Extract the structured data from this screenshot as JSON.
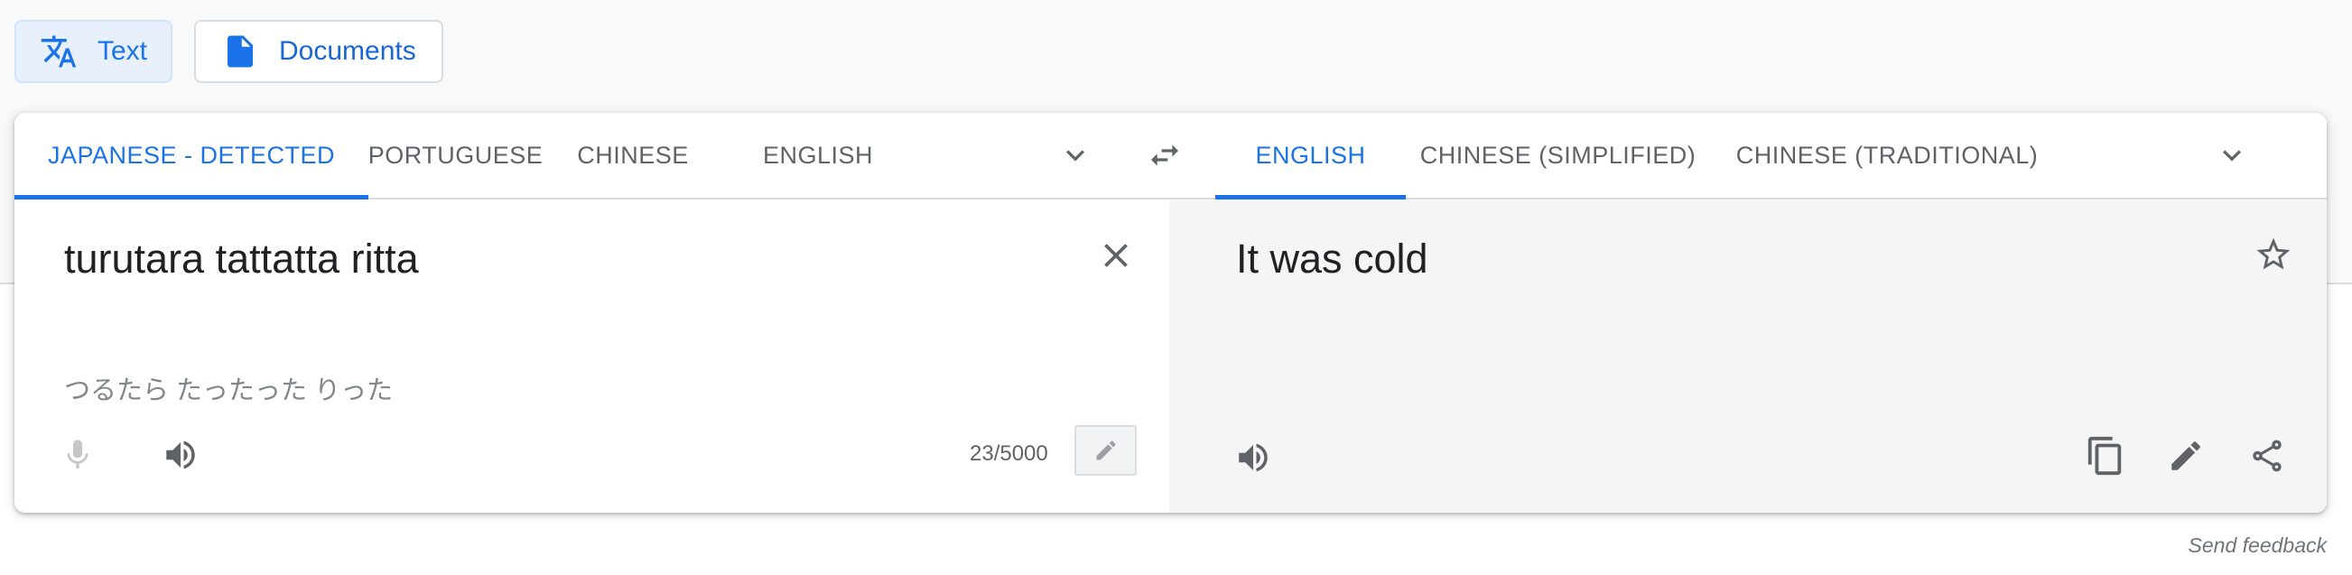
{
  "mode_buttons": {
    "text_label": "Text",
    "documents_label": "Documents"
  },
  "source_languages": [
    "JAPANESE - DETECTED",
    "PORTUGUESE",
    "CHINESE",
    "ENGLISH"
  ],
  "target_languages": [
    "ENGLISH",
    "CHINESE (SIMPLIFIED)",
    "CHINESE (TRADITIONAL)"
  ],
  "source": {
    "text": "turutara tattatta ritta",
    "transliteration": "つるたら たったった りった",
    "char_count": "23/5000"
  },
  "target": {
    "text": "It was cold"
  },
  "footer": {
    "feedback_label": "Send feedback"
  },
  "icons": {
    "translate": "translate-icon",
    "document": "document-icon",
    "more_languages": "chevron-down-icon",
    "swap": "swap-icon",
    "clear": "close-icon",
    "star": "star-icon",
    "mic": "microphone-icon",
    "listen": "speaker-icon",
    "edit": "pencil-icon",
    "copy": "copy-icon",
    "share": "share-icon"
  },
  "colors": {
    "accent": "#1a73e8",
    "active_button_bg": "#e8f0fe",
    "result_pane_bg": "#f5f5f5"
  }
}
